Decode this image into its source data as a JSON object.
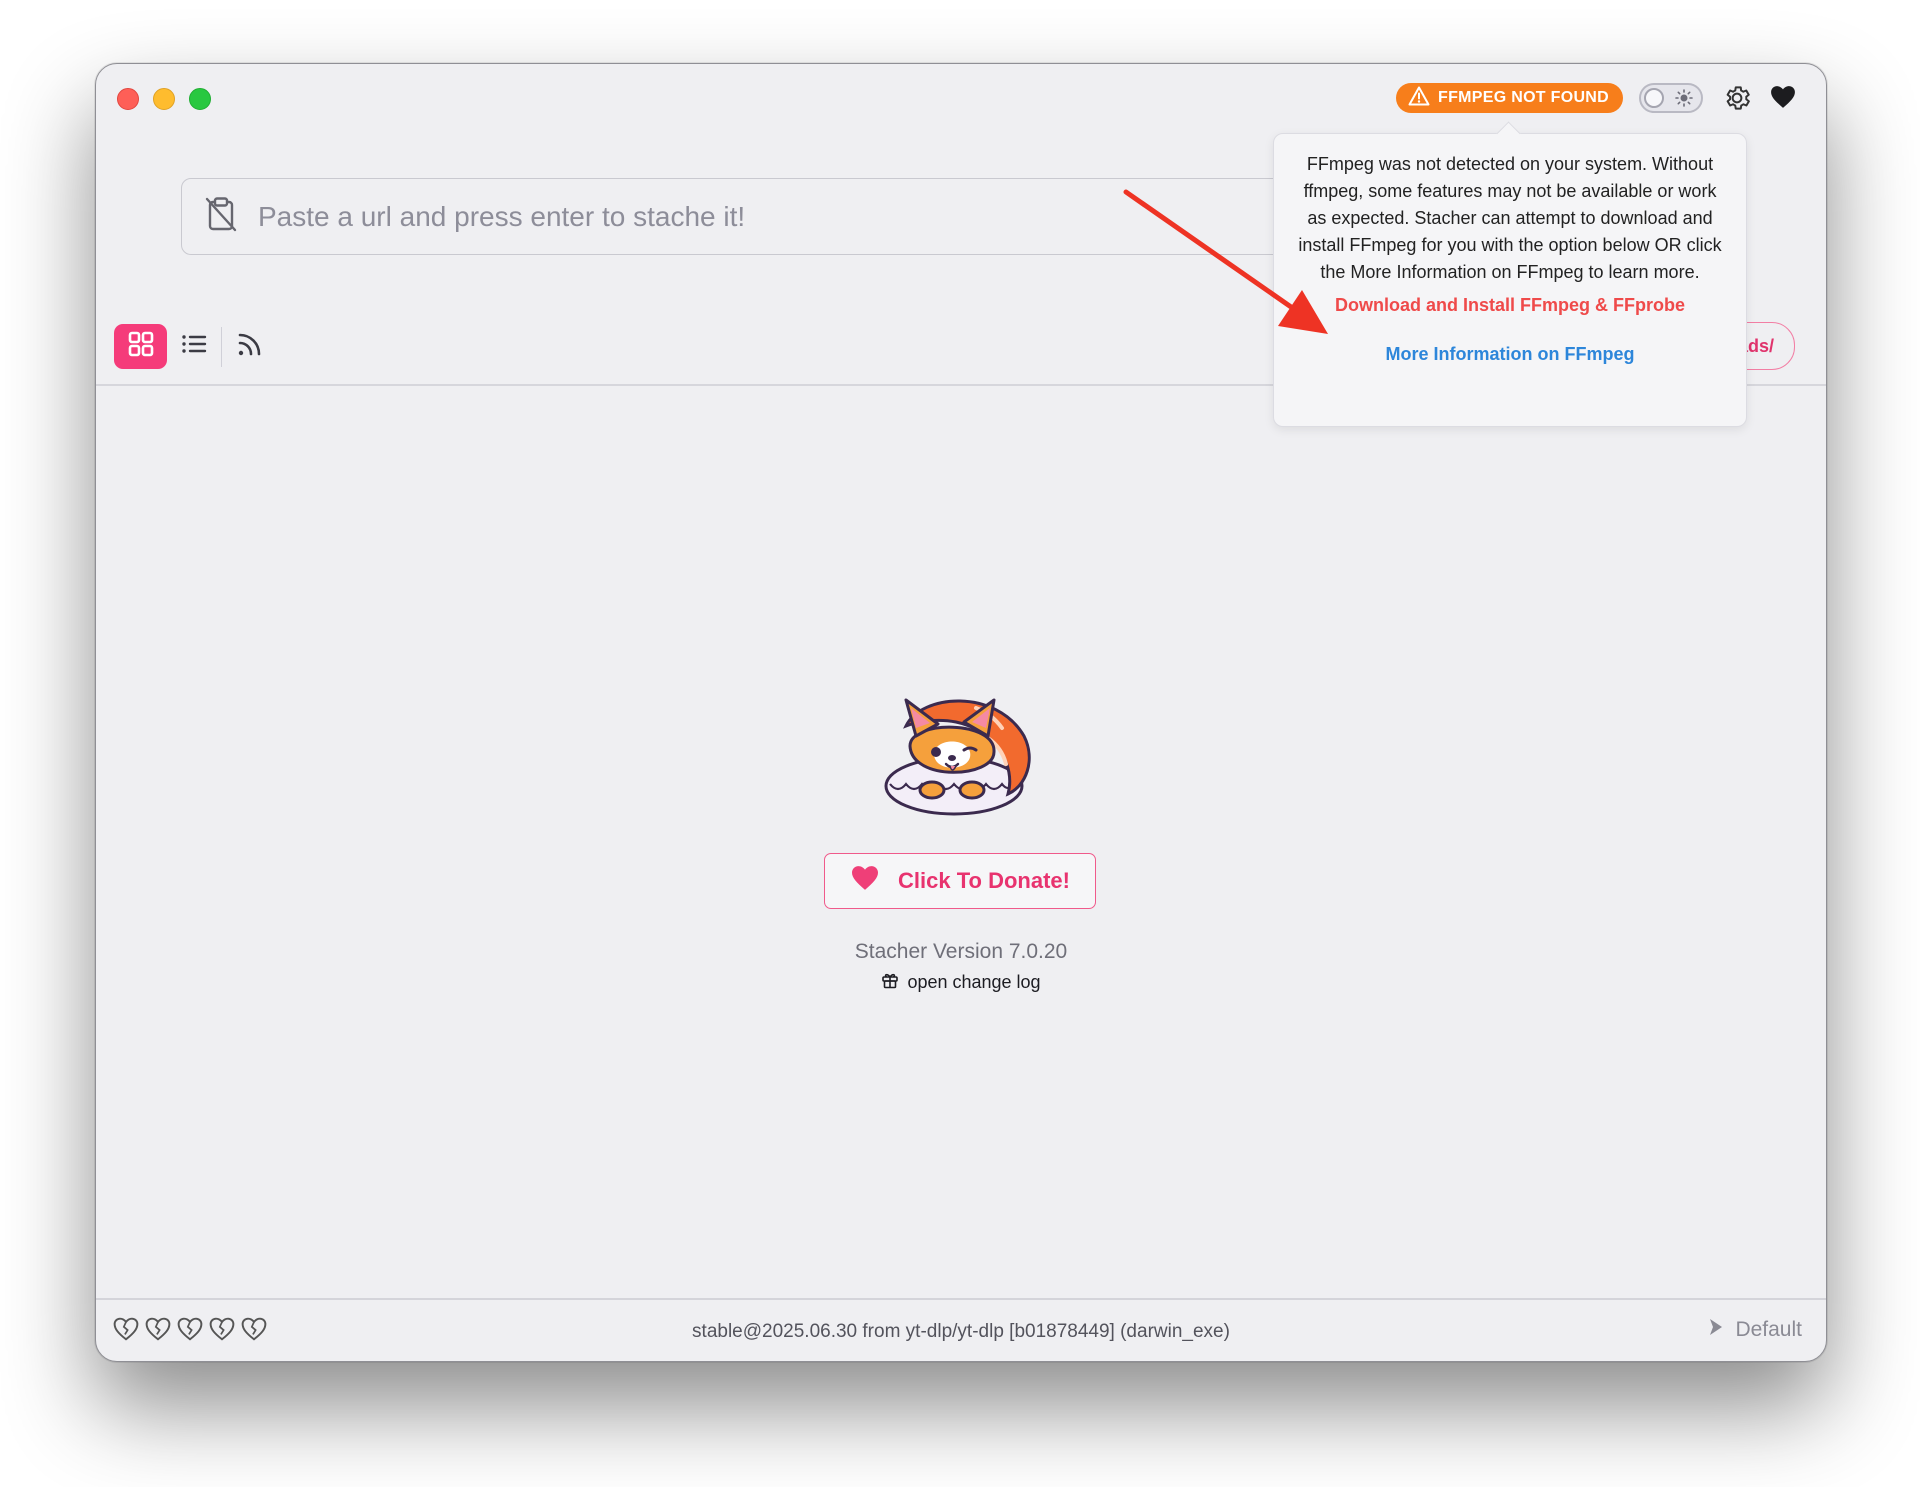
{
  "window": {
    "controls": [
      "close",
      "minimize",
      "zoom"
    ]
  },
  "header": {
    "ffmpeg_badge": "FFMPEG NOT FOUND",
    "theme_toggle": "light",
    "icons": [
      "warning-icon",
      "sun-icon",
      "gear-icon",
      "heart-icon"
    ]
  },
  "url_bar": {
    "placeholder": "Paste a url and press enter to stache it!",
    "icon": "clipboard-off-icon"
  },
  "view_switcher": {
    "items": [
      {
        "name": "grid",
        "active": true
      },
      {
        "name": "list",
        "active": false
      },
      {
        "name": "rss",
        "active": false
      }
    ]
  },
  "downloads_pill": {
    "text": "oads/"
  },
  "popover": {
    "message": "FFmpeg was not detected on your system. Without ffmpeg, some features may not be available or work as expected. Stacher can attempt to download and install FFmpeg for you with the option below OR click the More Information on FFmpeg to learn more.",
    "install_link": "Download and Install FFmpeg & FFprobe",
    "info_link": "More Information on FFmpeg"
  },
  "main": {
    "donate_label": "Click To Donate!",
    "version": "Stacher Version 7.0.20",
    "changelog": "open change log"
  },
  "footer": {
    "hearts_count": 5,
    "status": "stable@2025.06.30 from yt-dlp/yt-dlp [b01878449] (darwin_exe)",
    "profile": "Default"
  },
  "colors": {
    "accent": "#f53b7a",
    "warning": "#f77e1b",
    "link_red": "#ef4a4a",
    "link_blue": "#2d86da",
    "arrow": "#ee3324"
  }
}
